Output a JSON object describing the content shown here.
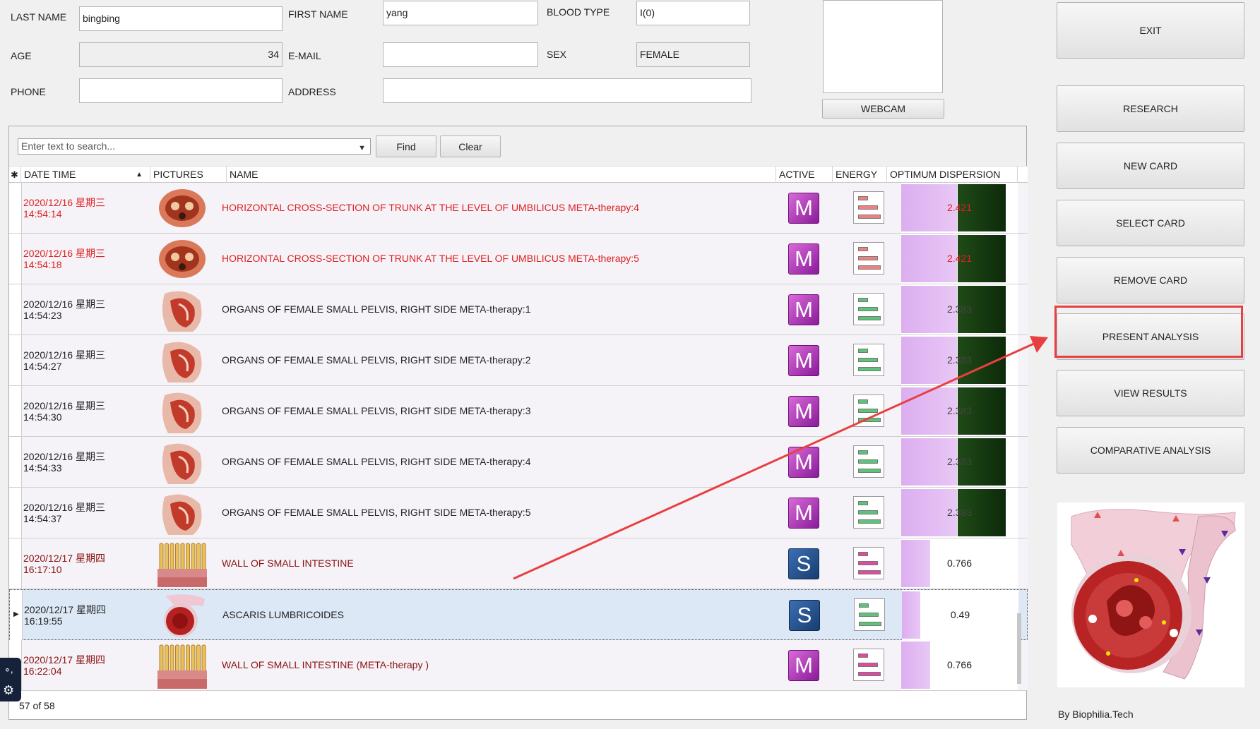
{
  "patient": {
    "last_name_label": "LAST NAME",
    "last_name": "bingbing",
    "first_name_label": "FIRST NAME",
    "first_name": "yang",
    "blood_type_label": "BLOOD TYPE",
    "blood_type": "I(0)",
    "age_label": "AGE",
    "age": "34",
    "email_label": "E-MAIL",
    "email": "",
    "sex_label": "SEX",
    "sex": "FEMALE",
    "phone_label": "PHONE",
    "phone": "",
    "address_label": "ADDRESS",
    "address": ""
  },
  "webcam": {
    "label": "WEBCAM"
  },
  "search": {
    "placeholder": "Enter text to search...",
    "find_label": "Find",
    "clear_label": "Clear"
  },
  "columns": {
    "date_time": "DATE TIME",
    "pictures": "PICTURES",
    "name": "NAME",
    "active": "ACTIVE",
    "energy": "ENERGY",
    "optimum": "OPTIMUM DISPERSION"
  },
  "rows": [
    {
      "date": "2020/12/16 星期三",
      "time": "14:54:14",
      "name": "HORIZONTAL CROSS-SECTION OF TRUNK AT THE LEVEL OF UMBILICUS META-therapy:4",
      "active": "M",
      "value": "2.421",
      "color": "#e02020",
      "fill": 0.48,
      "dark": true
    },
    {
      "date": "2020/12/16 星期三",
      "time": "14:54:18",
      "name": "HORIZONTAL CROSS-SECTION OF TRUNK AT THE LEVEL OF UMBILICUS META-therapy:5",
      "active": "M",
      "value": "2.421",
      "color": "#e02020",
      "fill": 0.48,
      "dark": true
    },
    {
      "date": "2020/12/16 星期三",
      "time": "14:54:23",
      "name": "ORGANS OF FEMALE SMALL PELVIS, RIGHT SIDE META-therapy:1",
      "active": "M",
      "value": "2.383",
      "color": "#222222",
      "fill": 0.48,
      "dark": true
    },
    {
      "date": "2020/12/16 星期三",
      "time": "14:54:27",
      "name": "ORGANS OF FEMALE SMALL PELVIS, RIGHT SIDE META-therapy:2",
      "active": "M",
      "value": "2.383",
      "color": "#222222",
      "fill": 0.48,
      "dark": true
    },
    {
      "date": "2020/12/16 星期三",
      "time": "14:54:30",
      "name": "ORGANS OF FEMALE SMALL PELVIS, RIGHT SIDE META-therapy:3",
      "active": "M",
      "value": "2.383",
      "color": "#222222",
      "fill": 0.48,
      "dark": true
    },
    {
      "date": "2020/12/16 星期三",
      "time": "14:54:33",
      "name": "ORGANS OF FEMALE SMALL PELVIS, RIGHT SIDE META-therapy:4",
      "active": "M",
      "value": "2.383",
      "color": "#222222",
      "fill": 0.48,
      "dark": true
    },
    {
      "date": "2020/12/16 星期三",
      "time": "14:54:37",
      "name": "ORGANS OF FEMALE SMALL PELVIS, RIGHT SIDE META-therapy:5",
      "active": "M",
      "value": "2.383",
      "color": "#222222",
      "fill": 0.48,
      "dark": true
    },
    {
      "date": "2020/12/17 星期四",
      "time": "16:17:10",
      "name": "WALL OF SMALL  INTESTINE",
      "active": "S",
      "value": "0.766",
      "color": "#8b1010",
      "fill": 0.25,
      "dark": false
    },
    {
      "date": "2020/12/17 星期四",
      "time": "16:19:55",
      "name": "ASCARIS  LUMBRICOIDES",
      "active": "S",
      "value": "0.49",
      "color": "#222222",
      "fill": 0.16,
      "dark": false,
      "selected": true
    },
    {
      "date": "2020/12/17 星期四",
      "time": "16:22:04",
      "name": "WALL OF SMALL  INTESTINE (META-therapy )",
      "active": "M",
      "value": "0.766",
      "color": "#8b1010",
      "fill": 0.25,
      "dark": false
    }
  ],
  "status": {
    "count": "57 of 58"
  },
  "actions": {
    "exit": "EXIT",
    "research": "RESEARCH",
    "new_card": "NEW CARD",
    "select_card": "SELECT CARD",
    "remove_card": "REMOVE CARD",
    "present_analysis": "PRESENT ANALYSIS",
    "view_results": "VIEW RESULTS",
    "comparative_analysis": "COMPARATIVE ANALYSIS"
  },
  "credit": "By Biophilia.Tech",
  "colors": {
    "annotation": "#e84040",
    "accent_m": "#a53bb3",
    "accent_s": "#23528f"
  }
}
